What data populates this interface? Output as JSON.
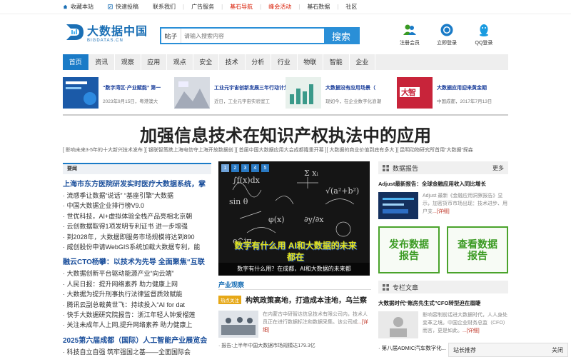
{
  "topbar": {
    "bookmark": "收藏本站",
    "contribute": "快速投稿",
    "links": [
      "联系我们",
      "广告服务",
      "基石导航",
      "峰会活动",
      "基石数据",
      "社区"
    ]
  },
  "header": {
    "logo_cn": "大数据中国",
    "logo_en": "BIGDATAS.CN",
    "search_category": "帖子",
    "search_placeholder": "请输入搜索内容",
    "search_button": "搜索",
    "icons": [
      {
        "name": "register-icon",
        "label": "注册会员"
      },
      {
        "name": "chrome-icon",
        "label": "立即登录"
      },
      {
        "name": "qq-icon",
        "label": "QQ登录"
      }
    ]
  },
  "nav": [
    "首页",
    "资讯",
    "观察",
    "应用",
    "观点",
    "安全",
    "技术",
    "分析",
    "行业",
    "物联",
    "智能",
    "企业"
  ],
  "strip": [
    {
      "title": "“数字湾区·产业赋能” 第一",
      "sub": "2023年9月15日，粤港澳大"
    },
    {
      "title": "工业元宇宙创新发展三年行动计划",
      "sub": "近日，工业元宇宙实验室工"
    },
    {
      "title": "大数据没有应用场景（",
      "sub": "现如今，在企业数字化浪潮"
    },
    {
      "title": "大数据应用迎来黄金期",
      "sub": "中国成都，2017年7月13日"
    }
  ],
  "headline": "加强信息技术在知识产权执法中的应用",
  "related": "[ 影响未来3-5年的十大新兴技术发布 ][ 银联智策携上海电信夺上海开放数据创 ][ 首届中国大数据应用大会成都隆重开幕 ][ 大数据的商业价值到底有多大 ][ 昆明动物研究所首用“大数据”探森",
  "left": {
    "header": "要闻",
    "sections": [
      {
        "title": "上海市东方医院研发实时医疗大数据系统，掌",
        "items": [
          "流感季让数据“说话” “基座引擎”大数据",
          "中国大数据企业排行榜V9.0",
          "世优科技，AI+虚拟体验全栈产品亮相北京朝",
          "云创数据取得1项发明专利证书 进一步增强",
          "到2028年，大数据即服务市场规模将达到890",
          "威创股份申请WebGIS系统加载大数据专利，能"
        ]
      },
      {
        "title": "融云CTO杨攀：以技术为先导 全面聚焦“互联",
        "items": [
          "大数据创新平台驱动能源产业“向云端”",
          "人民日报：提升网络素养 助力健康上网",
          "大数据为提升刑事执行法律监督质效赋能",
          "腾讯云副总裁黄世飞：持续投入“AI for dat",
          "快手大数据研究院报告：浙江年轻人钟爱榴莲",
          "关注未成年人上网,提升网络素养 助力健康上"
        ]
      },
      {
        "title": "2025第六届成都（国际）人工智能产业展览会",
        "items": [
          "科技自立自强 筑牢强国之基——全面国际会"
        ]
      }
    ]
  },
  "mid": {
    "pages": [
      "1",
      "2",
      "3",
      "4",
      "5"
    ],
    "slide_text": "数字有什么用 AI和大数据的未来都在",
    "caption": "数字有什么用？在成都，AI和大数据的未来都",
    "section_title": "产业观察",
    "hot_tag": "热点关注",
    "hot_title": "构筑政策高地，打造成本洼地，乌兰察",
    "article": "在内蒙古中研智达信息技术有限公司内，技术人员正在进行数据标注和数据采集。该公司成",
    "more": "...[详细]",
    "list_item": "· 报告:上半年中国大数据市场规模达179.3亿"
  },
  "right": {
    "report_header": "数据报告",
    "report_more": "更多",
    "report_title": "Adjust最新报告：全球金融应用收入同比增长",
    "report_text": "Adjust 最新《金融应用洞察报告》显示，加密货币市场出现：技术进步、用户支",
    "more": "...[详细]",
    "btn_publish": "发布数据报告",
    "btn_view": "查看数据报告",
    "col_header": "专栏文章",
    "col_title": "大数据时代“账房先生式”CFO转型迫在眉睫",
    "col_text": "影响容制前话进大数据时代，人人身处变革之境。中国企业财务总监（CFO）而言，更是如此。",
    "next": "· 第八届ADMIC汽车数字化..."
  },
  "popup": {
    "label": "站长推荐",
    "close": "关闭"
  }
}
